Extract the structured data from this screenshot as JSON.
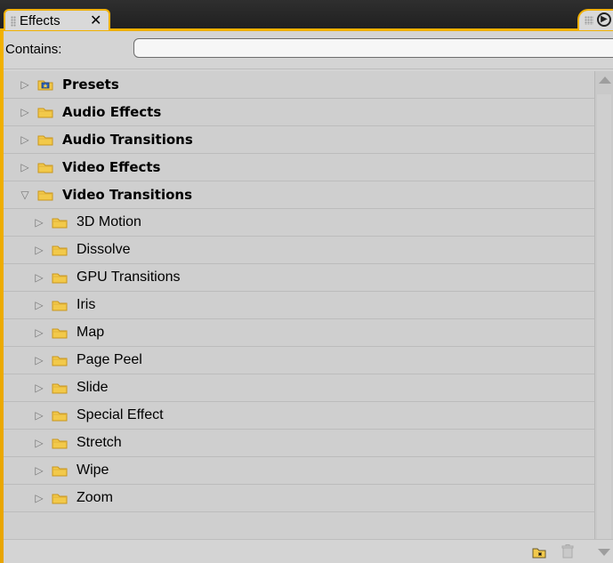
{
  "tab": {
    "title": "Effects",
    "close": "✕"
  },
  "search": {
    "label": "Contains:",
    "value": ""
  },
  "tree": {
    "items": [
      {
        "label": "Presets",
        "level": 0,
        "expanded": false,
        "icon": "preset-folder-icon"
      },
      {
        "label": "Audio Effects",
        "level": 0,
        "expanded": false,
        "icon": "folder-icon"
      },
      {
        "label": "Audio Transitions",
        "level": 0,
        "expanded": false,
        "icon": "folder-icon"
      },
      {
        "label": "Video Effects",
        "level": 0,
        "expanded": false,
        "icon": "folder-icon"
      },
      {
        "label": "Video Transitions",
        "level": 0,
        "expanded": true,
        "icon": "folder-icon"
      },
      {
        "label": "3D Motion",
        "level": 1,
        "expanded": false,
        "icon": "folder-icon"
      },
      {
        "label": "Dissolve",
        "level": 1,
        "expanded": false,
        "icon": "folder-icon"
      },
      {
        "label": "GPU Transitions",
        "level": 1,
        "expanded": false,
        "icon": "folder-icon"
      },
      {
        "label": "Iris",
        "level": 1,
        "expanded": false,
        "icon": "folder-icon"
      },
      {
        "label": "Map",
        "level": 1,
        "expanded": false,
        "icon": "folder-icon"
      },
      {
        "label": "Page Peel",
        "level": 1,
        "expanded": false,
        "icon": "folder-icon"
      },
      {
        "label": "Slide",
        "level": 1,
        "expanded": false,
        "icon": "folder-icon"
      },
      {
        "label": "Special Effect",
        "level": 1,
        "expanded": false,
        "icon": "folder-icon"
      },
      {
        "label": "Stretch",
        "level": 1,
        "expanded": false,
        "icon": "folder-icon"
      },
      {
        "label": "Wipe",
        "level": 1,
        "expanded": false,
        "icon": "folder-icon"
      },
      {
        "label": "Zoom",
        "level": 1,
        "expanded": false,
        "icon": "folder-icon"
      }
    ]
  },
  "colors": {
    "accent": "#f0b000",
    "folder": "#f2c94a",
    "folder_dark": "#c8961c"
  },
  "icons": {
    "panel_menu": "panel-menu-icon",
    "scroll_up": "scroll-up-icon",
    "scroll_down": "scroll-down-icon",
    "new_bin": "new-bin-icon",
    "delete": "trash-icon"
  }
}
